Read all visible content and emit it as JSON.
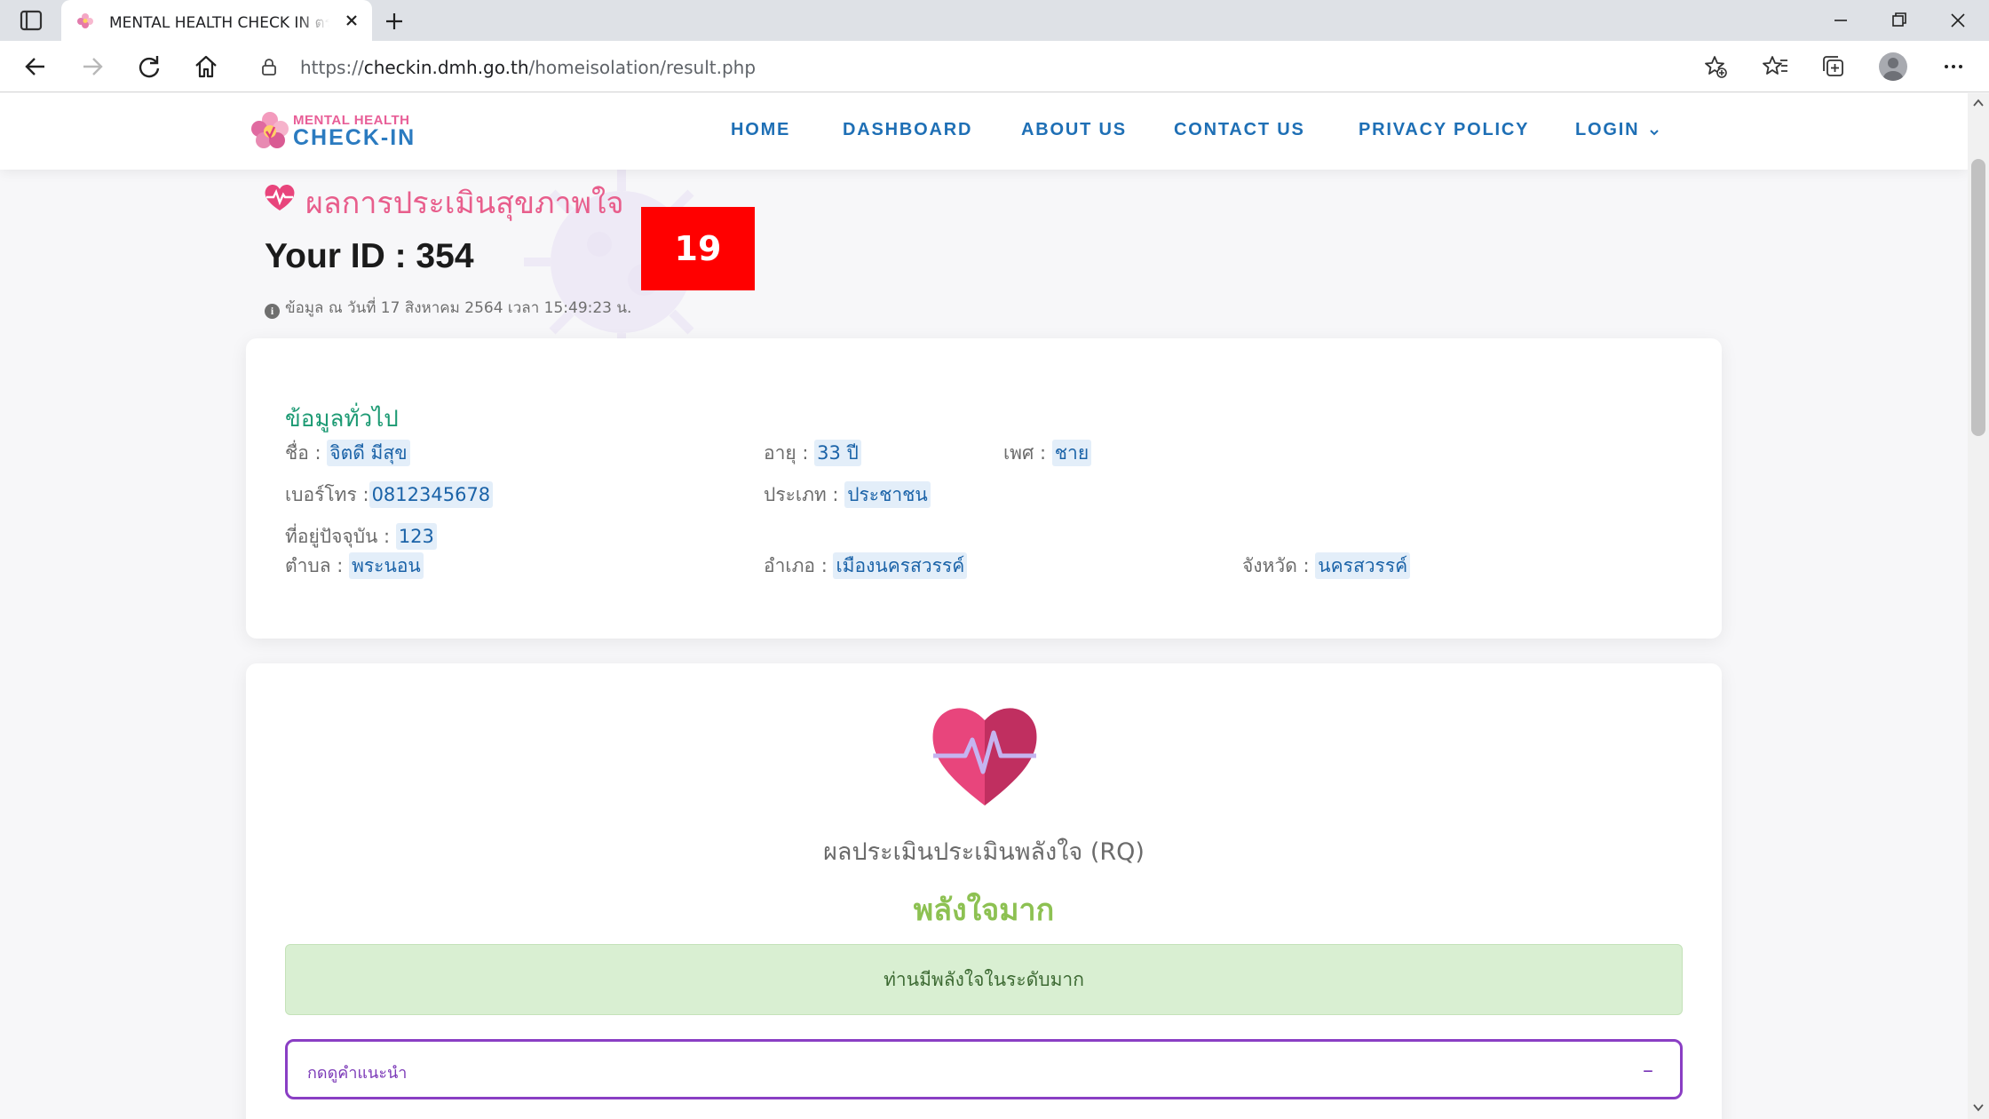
{
  "browser": {
    "tab_title": "MENTAL HEALTH CHECK IN ตรวจ",
    "url_prefix": "https://",
    "url_host": "checkin.dmh.go.th",
    "url_path": "/homeisolation/result.php",
    "icons": [
      "tab-actions-icon",
      "favicon-icon",
      "close-tab-icon",
      "new-tab-icon",
      "minimize-icon",
      "restore-icon",
      "close-window-icon",
      "back-icon",
      "forward-icon",
      "refresh-icon",
      "home-icon",
      "lock-icon",
      "add-favorite-icon",
      "favorites-icon",
      "collections-icon",
      "profile-avatar",
      "more-icon"
    ]
  },
  "site": {
    "logo_line1": "MENTAL HEALTH",
    "logo_line2": "CHECK-IN",
    "menu": {
      "home": "HOME",
      "dashboard": "DASHBOARD",
      "about": "ABOUT US",
      "contact": "CONTACT US",
      "privacy": "PRIVACY POLICY",
      "login": "LOGIN"
    },
    "heading": "ผลการประเมินสุขภาพใจ",
    "your_id": "Your ID : 354",
    "timestamp": "ข้อมูล ณ วันที่ 17 สิงหาคม 2564 เวลา 15:49:23 น.",
    "badge": "19"
  },
  "general_info": {
    "title": "ข้อมูลทั่วไป",
    "name_label": "ชื่อ : ",
    "name_value": "จิตดี มีสุข",
    "age_label": "อายุ : ",
    "age_value": "33 ปี",
    "sex_label": "เพศ : ",
    "sex_value": "ชาย",
    "phone_label": "เบอร์โทร :",
    "phone_value": "0812345678",
    "type_label": "ประเภท : ",
    "type_value": "ประชาชน",
    "address_label": "ที่อยู่ปัจจุบัน : ",
    "address_value": "123",
    "subdistrict_label": "ตำบล : ",
    "subdistrict_value": "พระนอน",
    "district_label": "อำเภอ : ",
    "district_value": "เมืองนครสวรรค์",
    "province_label": "จังหวัด : ",
    "province_value": "นครสวรรค์"
  },
  "result": {
    "title": "ผลประเมินประเมินพลังใจ (RQ)",
    "level": "พลังใจมาก",
    "message": "ท่านมีพลังใจในระดับมาก",
    "advice_label": "กดดูคำแนะนำ",
    "advice_toggle": "–"
  },
  "colors": {
    "nav_blue": "#1e6fb5",
    "heading_pink": "#e85e8c",
    "section_green": "#1c9a73",
    "level_green": "#8dc152",
    "alert_bg": "#d9efd2",
    "accordion_purple": "#8a3ec4",
    "badge_red": "#ff0000"
  }
}
